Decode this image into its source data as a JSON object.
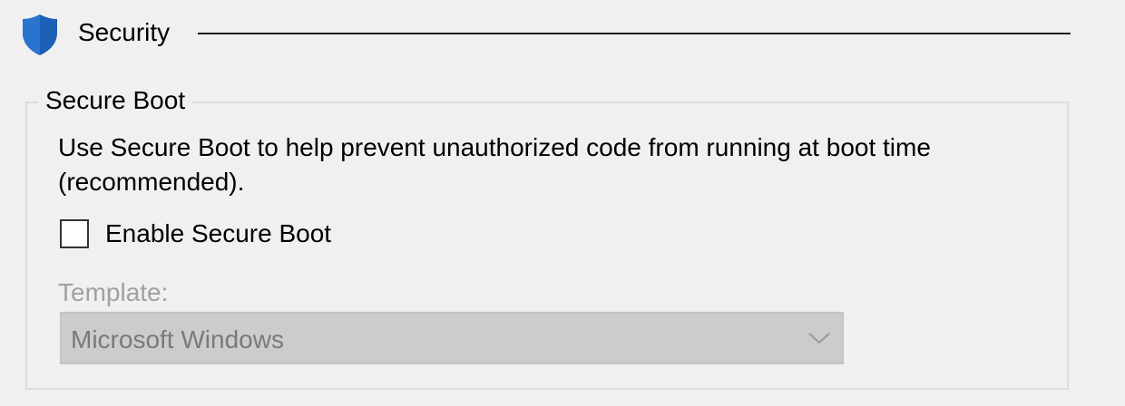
{
  "section": {
    "title": "Security",
    "icon": "shield-icon",
    "accent_color": "#1c5fb5"
  },
  "secure_boot": {
    "group_label": "Secure Boot",
    "description": "Use Secure Boot to help prevent unauthorized code from running at boot time (recommended).",
    "checkbox": {
      "label": "Enable Secure Boot",
      "checked": false
    },
    "template": {
      "label": "Template:",
      "selected_value": "Microsoft Windows",
      "enabled": false
    }
  }
}
